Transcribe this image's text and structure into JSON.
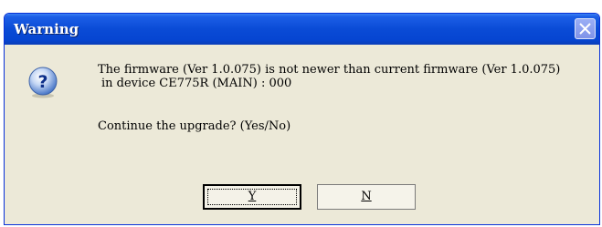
{
  "window": {
    "title": "Warning"
  },
  "message": {
    "line1": "The firmware (Ver 1.0.075) is not newer than current firmware (Ver 1.0.075)",
    "line2": "in device CE775R (MAIN) : 000",
    "question": "Continue the upgrade? (Yes/No)"
  },
  "buttons": {
    "yes_label": "Y",
    "no_label": "N"
  },
  "icons": {
    "dialog": "question-icon",
    "close": "close-icon"
  },
  "colors": {
    "titlebar": "#0a4bd6",
    "dialog_bg": "#ece9d8",
    "close_button": "#8a9ef0"
  }
}
